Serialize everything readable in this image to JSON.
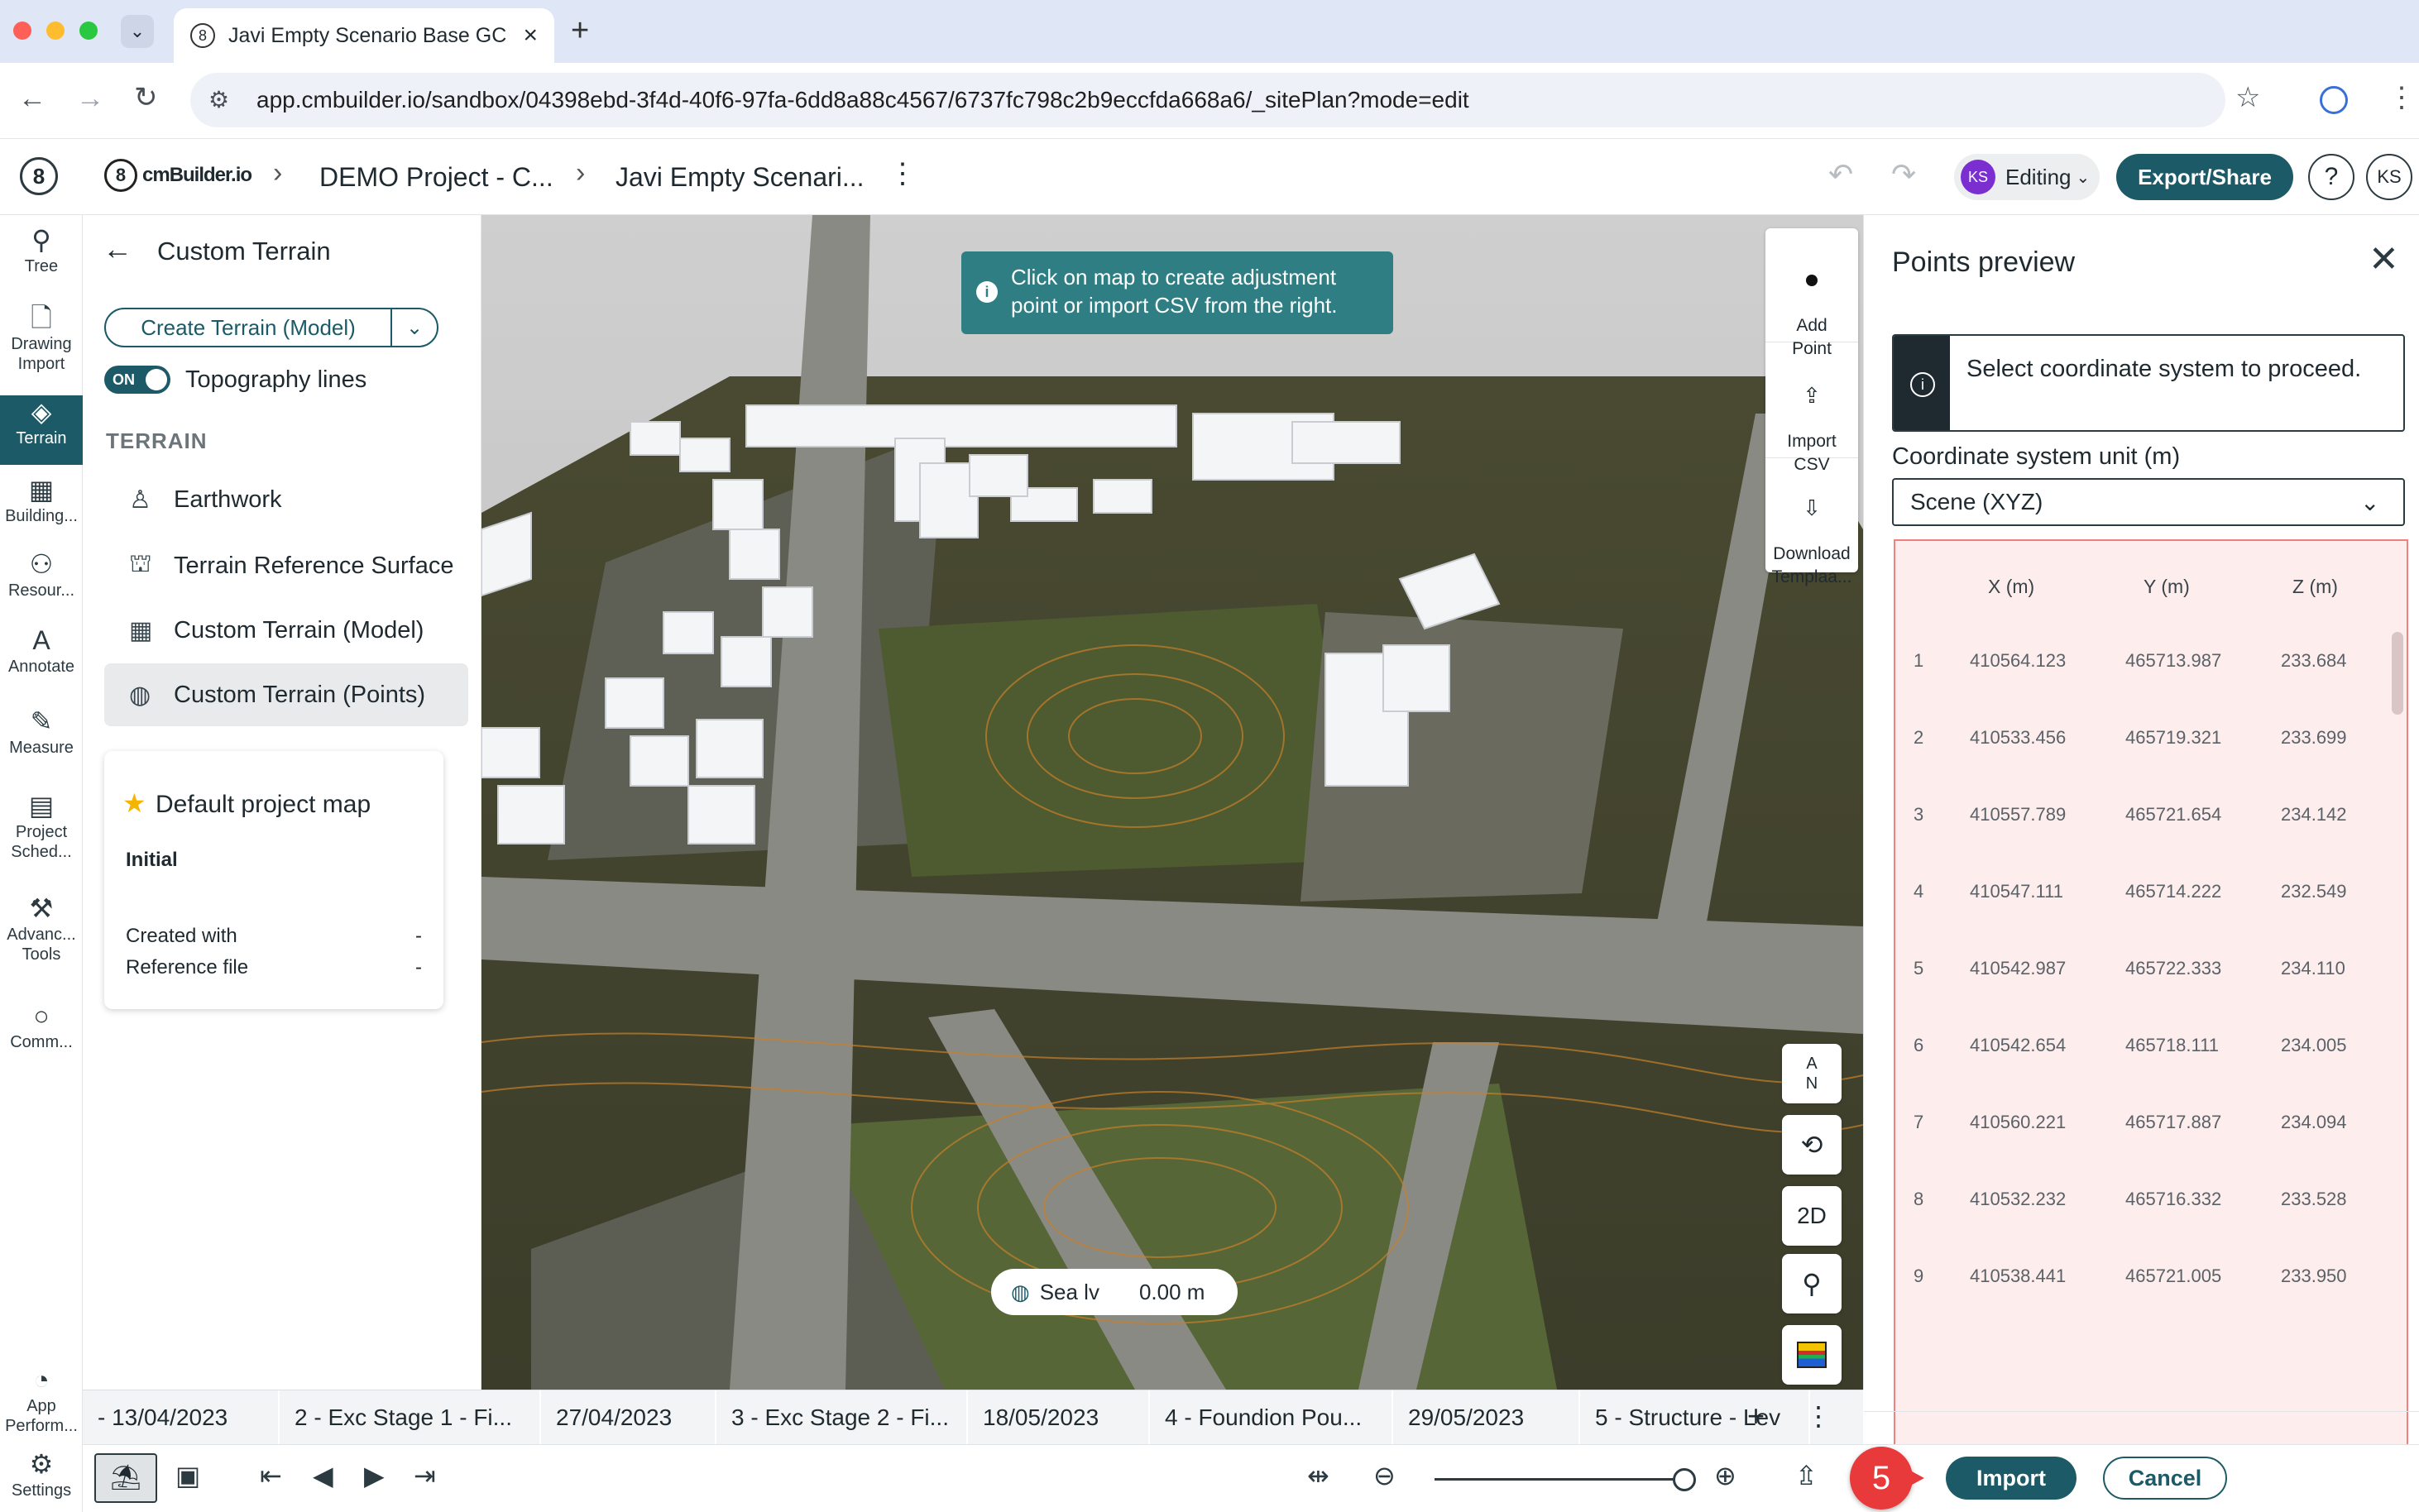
{
  "browser": {
    "tab_title": "Javi Empty Scenario Base GC",
    "tab_close": "×",
    "new_tab": "+",
    "url": "app.cmbuilder.io/sandbox/04398ebd-3f4d-40f6-97fa-6dd8a88c4567/6737fc798c2b9eccfda668a6/_sitePlan?mode=edit",
    "traffic_colors": [
      "#fe5f57",
      "#febc2e",
      "#28c840"
    ]
  },
  "header": {
    "logo_badge": "8",
    "logo_text": "cmBuilder.io",
    "breadcrumbs": [
      "DEMO Project - C...",
      "Javi Empty Scenari..."
    ],
    "editing_avatar": "KS",
    "editing_label": "Editing",
    "export_label": "Export/Share",
    "help_label": "?",
    "user_initials": "KS",
    "accent": "#1b5a66"
  },
  "rail": {
    "items": [
      {
        "label": "Tree",
        "icon": "tree-icon"
      },
      {
        "label": "Drawing\nImport",
        "icon": "drawing-import-icon"
      },
      {
        "label": "Terrain",
        "icon": "terrain-icon"
      },
      {
        "label": "Building...",
        "icon": "building-icon"
      },
      {
        "label": "Resour...",
        "icon": "resources-icon"
      },
      {
        "label": "Annotate",
        "icon": "annotate-icon"
      },
      {
        "label": "Measure",
        "icon": "measure-icon"
      },
      {
        "label": "Project\nSched...",
        "icon": "schedule-icon"
      },
      {
        "label": "Advanc...\nTools",
        "icon": "tools-icon"
      },
      {
        "label": "Comm...",
        "icon": "comments-icon"
      },
      {
        "label": "App\nPerform...",
        "icon": "performance-icon"
      },
      {
        "label": "Settings",
        "icon": "settings-icon"
      }
    ]
  },
  "terrain_panel": {
    "title": "Custom Terrain",
    "create_button": "Create Terrain (Model)",
    "toggle_state": "ON",
    "toggle_label": "Topography lines",
    "section_label": "TERRAIN",
    "menu": [
      "Earthwork",
      "Terrain Reference Surface",
      "Custom Terrain (Model)",
      "Custom Terrain (Points)"
    ],
    "card": {
      "title": "Default project map",
      "subtitle": "Initial",
      "rows": [
        {
          "label": "Created with",
          "value": "-"
        },
        {
          "label": "Reference file",
          "value": "-"
        }
      ]
    }
  },
  "map": {
    "hint": "Click on map to create adjustment point or import CSV from the right.",
    "sea_label": "Sea lv",
    "sea_value": "0.00 m",
    "tools": [
      {
        "label": "Add\nPoint",
        "icon": "add-point-icon"
      },
      {
        "label": "Import\nCSV",
        "icon": "import-csv-icon"
      },
      {
        "label": "Download\nTemplaa...",
        "icon": "download-template-icon"
      }
    ],
    "compass": "A\nN",
    "view_2d": "2D"
  },
  "points_panel": {
    "title": "Points preview",
    "notice": "Select coordinate system to proceed.",
    "unit_label": "Coordinate system unit (m)",
    "unit_value": "Scene (XYZ)",
    "columns": [
      "X (m)",
      "Y (m)",
      "Z (m)"
    ],
    "rows": [
      {
        "n": "1",
        "x": "410564.123",
        "y": "465713.987",
        "z": "233.684"
      },
      {
        "n": "2",
        "x": "410533.456",
        "y": "465719.321",
        "z": "233.699"
      },
      {
        "n": "3",
        "x": "410557.789",
        "y": "465721.654",
        "z": "234.142"
      },
      {
        "n": "4",
        "x": "410547.111",
        "y": "465714.222",
        "z": "232.549"
      },
      {
        "n": "5",
        "x": "410542.987",
        "y": "465722.333",
        "z": "234.110"
      },
      {
        "n": "6",
        "x": "410542.654",
        "y": "465718.111",
        "z": "234.005"
      },
      {
        "n": "7",
        "x": "410560.221",
        "y": "465717.887",
        "z": "234.094"
      },
      {
        "n": "8",
        "x": "410532.232",
        "y": "465716.332",
        "z": "233.528"
      },
      {
        "n": "9",
        "x": "410538.441",
        "y": "465721.005",
        "z": "233.950"
      }
    ],
    "step_badge": "5",
    "import_label": "Import",
    "cancel_label": "Cancel"
  },
  "timeline": {
    "cells": [
      "- 13/04/2023",
      "2 - Exc Stage 1 - Fi...",
      "27/04/2023",
      "3 - Exc Stage 2 - Fi...",
      "18/05/2023",
      "4 - Foundion Pou...",
      "29/05/2023",
      "5 - Structure - Lev"
    ],
    "add": "+",
    "more": "⋮"
  }
}
